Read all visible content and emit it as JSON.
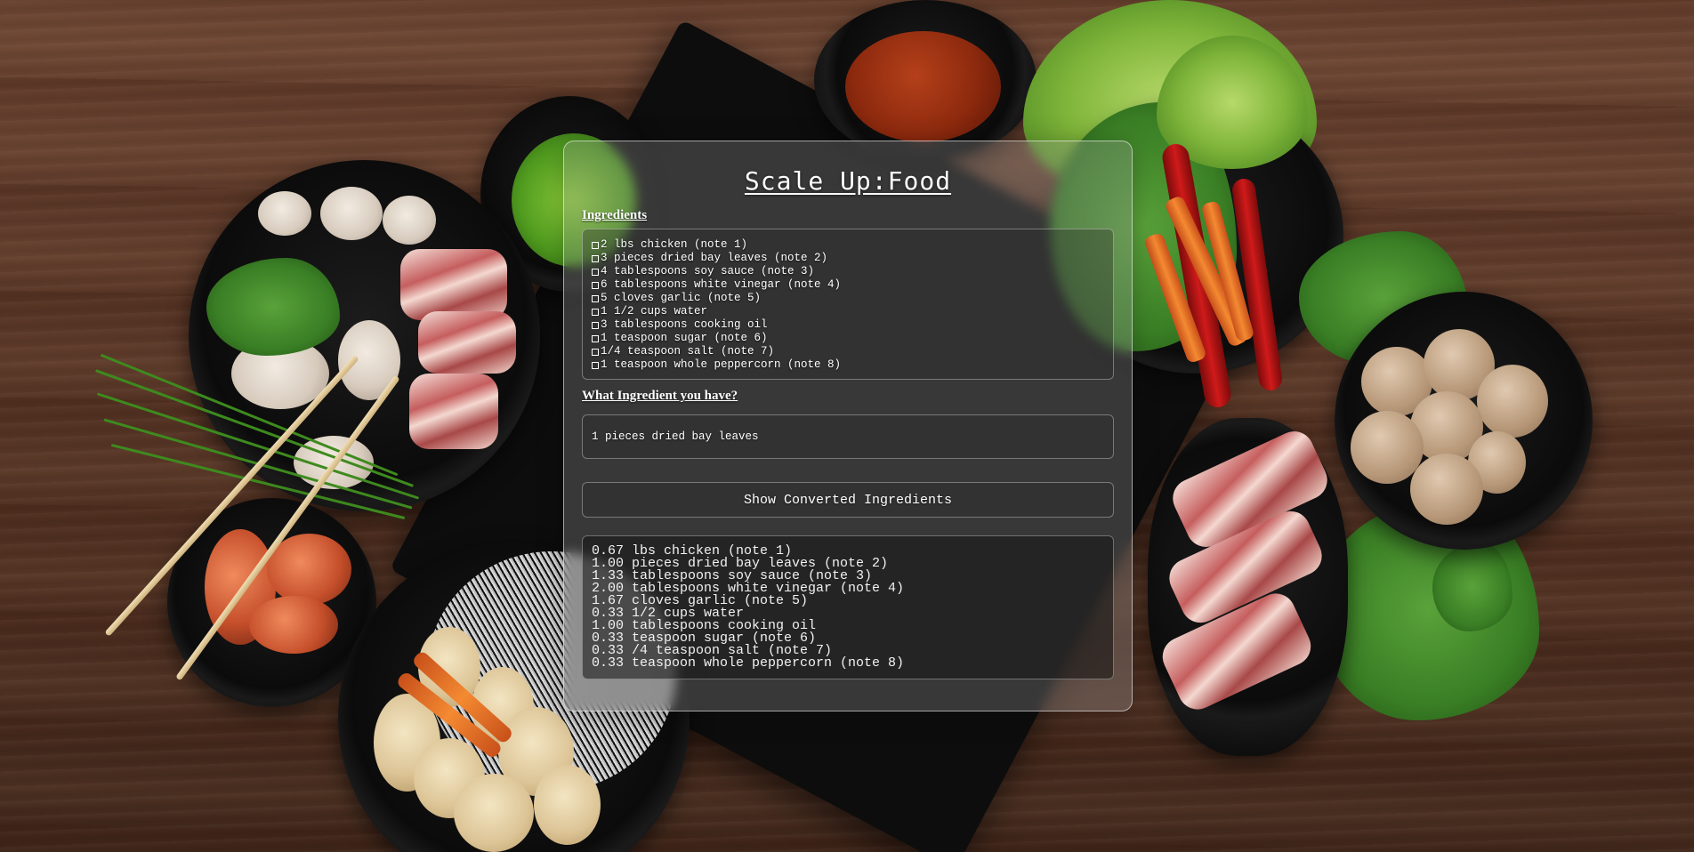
{
  "app": {
    "title": "Scale Up:Food"
  },
  "ingredients": {
    "label": "Ingredients",
    "items": [
      "2 lbs chicken (note 1)",
      "3 pieces dried bay leaves (note 2)",
      "4 tablespoons soy sauce (note 3)",
      "6 tablespoons white vinegar (note 4)",
      "5 cloves garlic (note 5)",
      "1 1/2 cups water",
      "3 tablespoons cooking oil",
      "1 teaspoon sugar (note 6)",
      "1/4 teaspoon salt (note 7)",
      "1 teaspoon whole peppercorn (note 8)"
    ]
  },
  "have": {
    "label": "What Ingredient you have?",
    "value": "1 pieces dried bay leaves"
  },
  "convert": {
    "button_label": "Show Converted Ingredients"
  },
  "converted": {
    "items": [
      "0.67 lbs chicken (note 1)",
      "1.00 pieces dried bay leaves (note 2)",
      "1.33 tablespoons soy sauce (note 3)",
      "2.00 tablespoons white vinegar (note 4)",
      "1.67 cloves garlic (note 5)",
      "0.33 1/2 cups water",
      "1.00 tablespoons cooking oil",
      "0.33 teaspoon sugar (note 6)",
      "0.33 /4 teaspoon salt (note 7)",
      "0.33 teaspoon whole peppercorn (note 8)"
    ]
  }
}
